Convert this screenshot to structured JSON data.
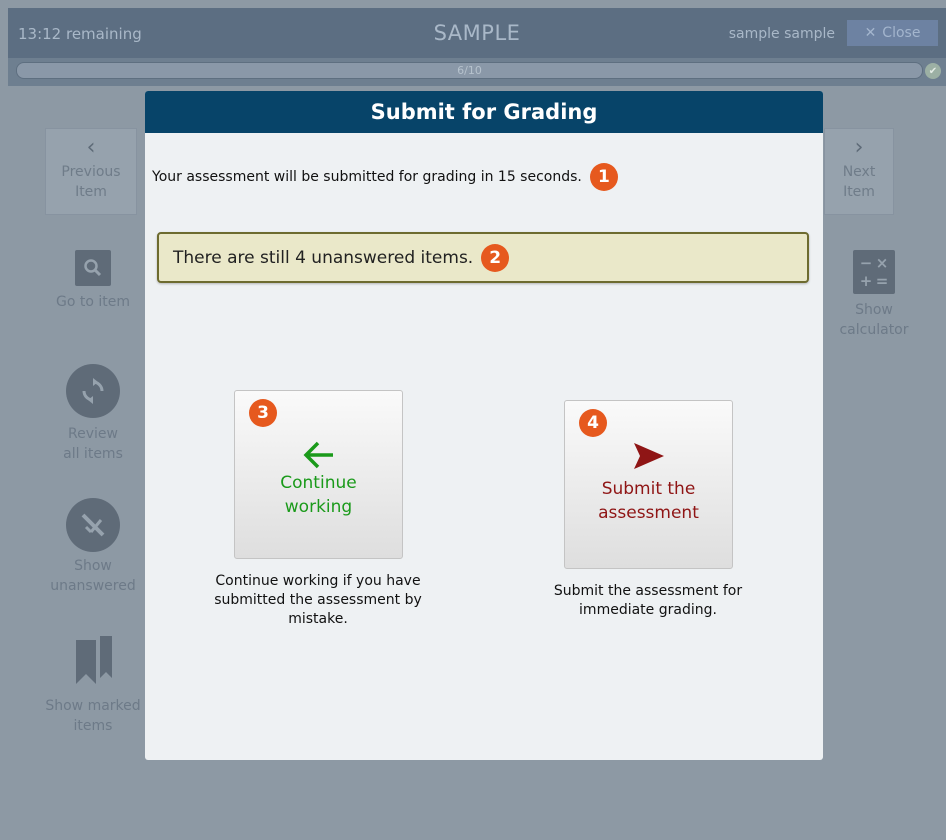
{
  "header": {
    "timer": "13:12 remaining",
    "title": "SAMPLE",
    "user": "sample sample",
    "close_label": "Close"
  },
  "progress": {
    "label": "6/10",
    "value": 0.6
  },
  "nav": {
    "previous_label": "Previous Item",
    "next_label": "Next Item"
  },
  "tools": {
    "go_to_item": "Go to item",
    "review_all": "Review all items",
    "show_unanswered": "Show unanswered",
    "show_marked": "Show marked items",
    "show_calculator": "Show calculator"
  },
  "modal": {
    "title": "Submit for Grading",
    "message": "Your assessment will be submitted for grading in 15 seconds.",
    "warning": "There are still 4 unanswered items.",
    "continue_label_1": "Continue",
    "continue_label_2": "working",
    "continue_desc": "Continue working if you have submitted the assessment by mistake.",
    "submit_label_1": "Submit the",
    "submit_label_2": "assessment",
    "submit_desc": "Submit the assessment for immediate grading.",
    "badges": [
      "1",
      "2",
      "3",
      "4"
    ]
  },
  "colors": {
    "modal_header": "#074469",
    "badge": "#e6591e",
    "continue": "#1a9a1a",
    "submit": "#8f1515",
    "warning_bg": "#eae8c9"
  },
  "icons": {
    "close": "close-icon",
    "search": "search-icon",
    "review": "refresh-icon",
    "unanswered": "hidden-icon",
    "marked": "bookmark-icon",
    "calculator": "calculator-icon",
    "continue": "arrow-left-icon",
    "submit": "send-icon"
  }
}
